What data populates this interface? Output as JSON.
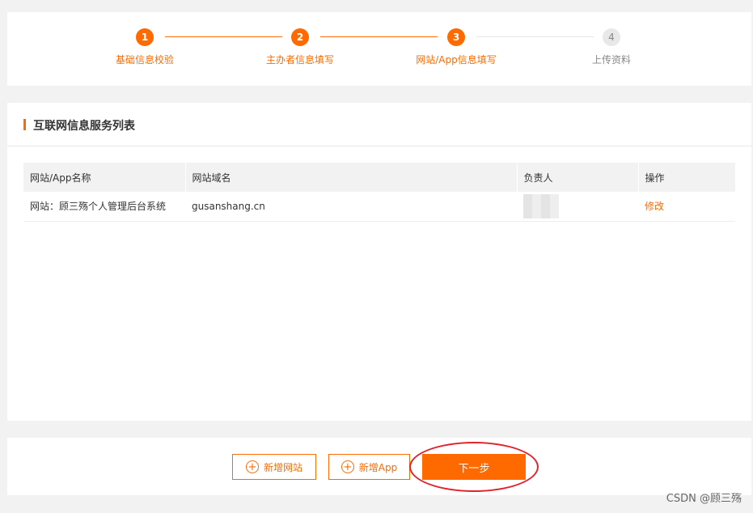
{
  "stepper": {
    "steps": [
      {
        "num": "1",
        "label": "基础信息校验"
      },
      {
        "num": "2",
        "label": "主办者信息填写"
      },
      {
        "num": "3",
        "label": "网站/App信息填写"
      },
      {
        "num": "4",
        "label": "上传资料"
      }
    ],
    "active_color": "#ff6a00",
    "inactive_color": "#e8e8e8"
  },
  "list": {
    "title": "互联网信息服务列表",
    "columns": [
      "网站/App名称",
      "网站域名",
      "负责人",
      "操作"
    ],
    "rows": [
      {
        "name": "网站：顾三殇个人管理后台系统",
        "domain": "gusanshang.cn",
        "owner": "",
        "action": "修改"
      }
    ]
  },
  "actions": {
    "add_website": "新增网站",
    "add_app": "新增App",
    "next": "下一步"
  },
  "icons": {
    "plus": "⊕"
  },
  "watermark": "CSDN @顾三殇"
}
